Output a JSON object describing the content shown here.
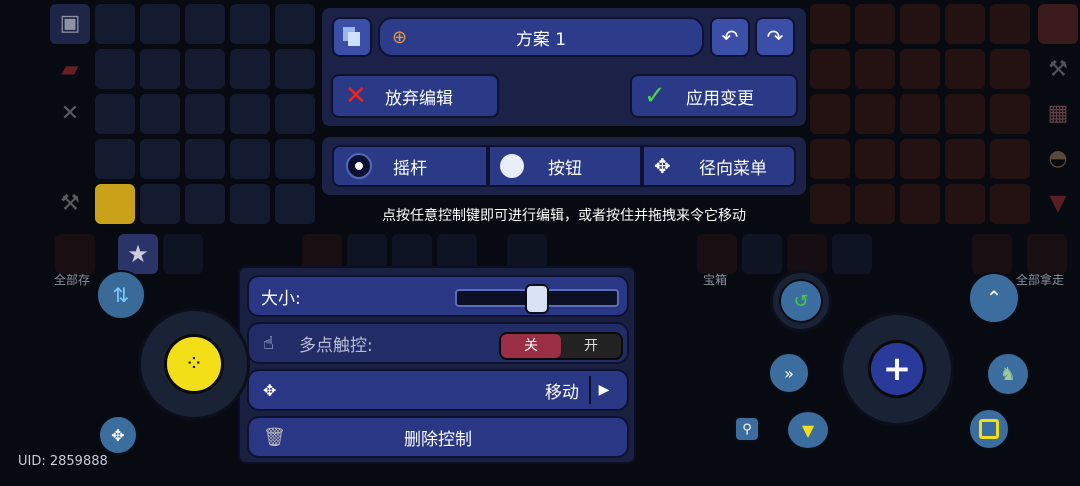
{
  "top_panel": {
    "preset_label": "方案 1",
    "discard_label": "放弃编辑",
    "apply_label": "应用变更"
  },
  "mode_tabs": [
    {
      "label": "摇杆"
    },
    {
      "label": "按钮"
    },
    {
      "label": "径向菜单"
    }
  ],
  "hint_text": "点按任意控制键即可进行编辑，或者按住并拖拽来令它移动",
  "settings_panel": {
    "size_label": "大小:",
    "size_value": 0.5,
    "multitouch_label": "多点触控:",
    "toggle_off": "关",
    "toggle_on": "开",
    "toggle_state": "off",
    "move_label": "移动",
    "delete_label": "删除控制"
  },
  "background_labels": {
    "left_deposit": "全部存",
    "chest": "宝箱",
    "right_loot": "全部拿走"
  },
  "uid_text": "UID: 2859888",
  "colors": {
    "panel": "#1b2147",
    "button": "#2a3a86",
    "accent_yellow": "#f2df18",
    "toggle_red": "#9a2e44"
  }
}
